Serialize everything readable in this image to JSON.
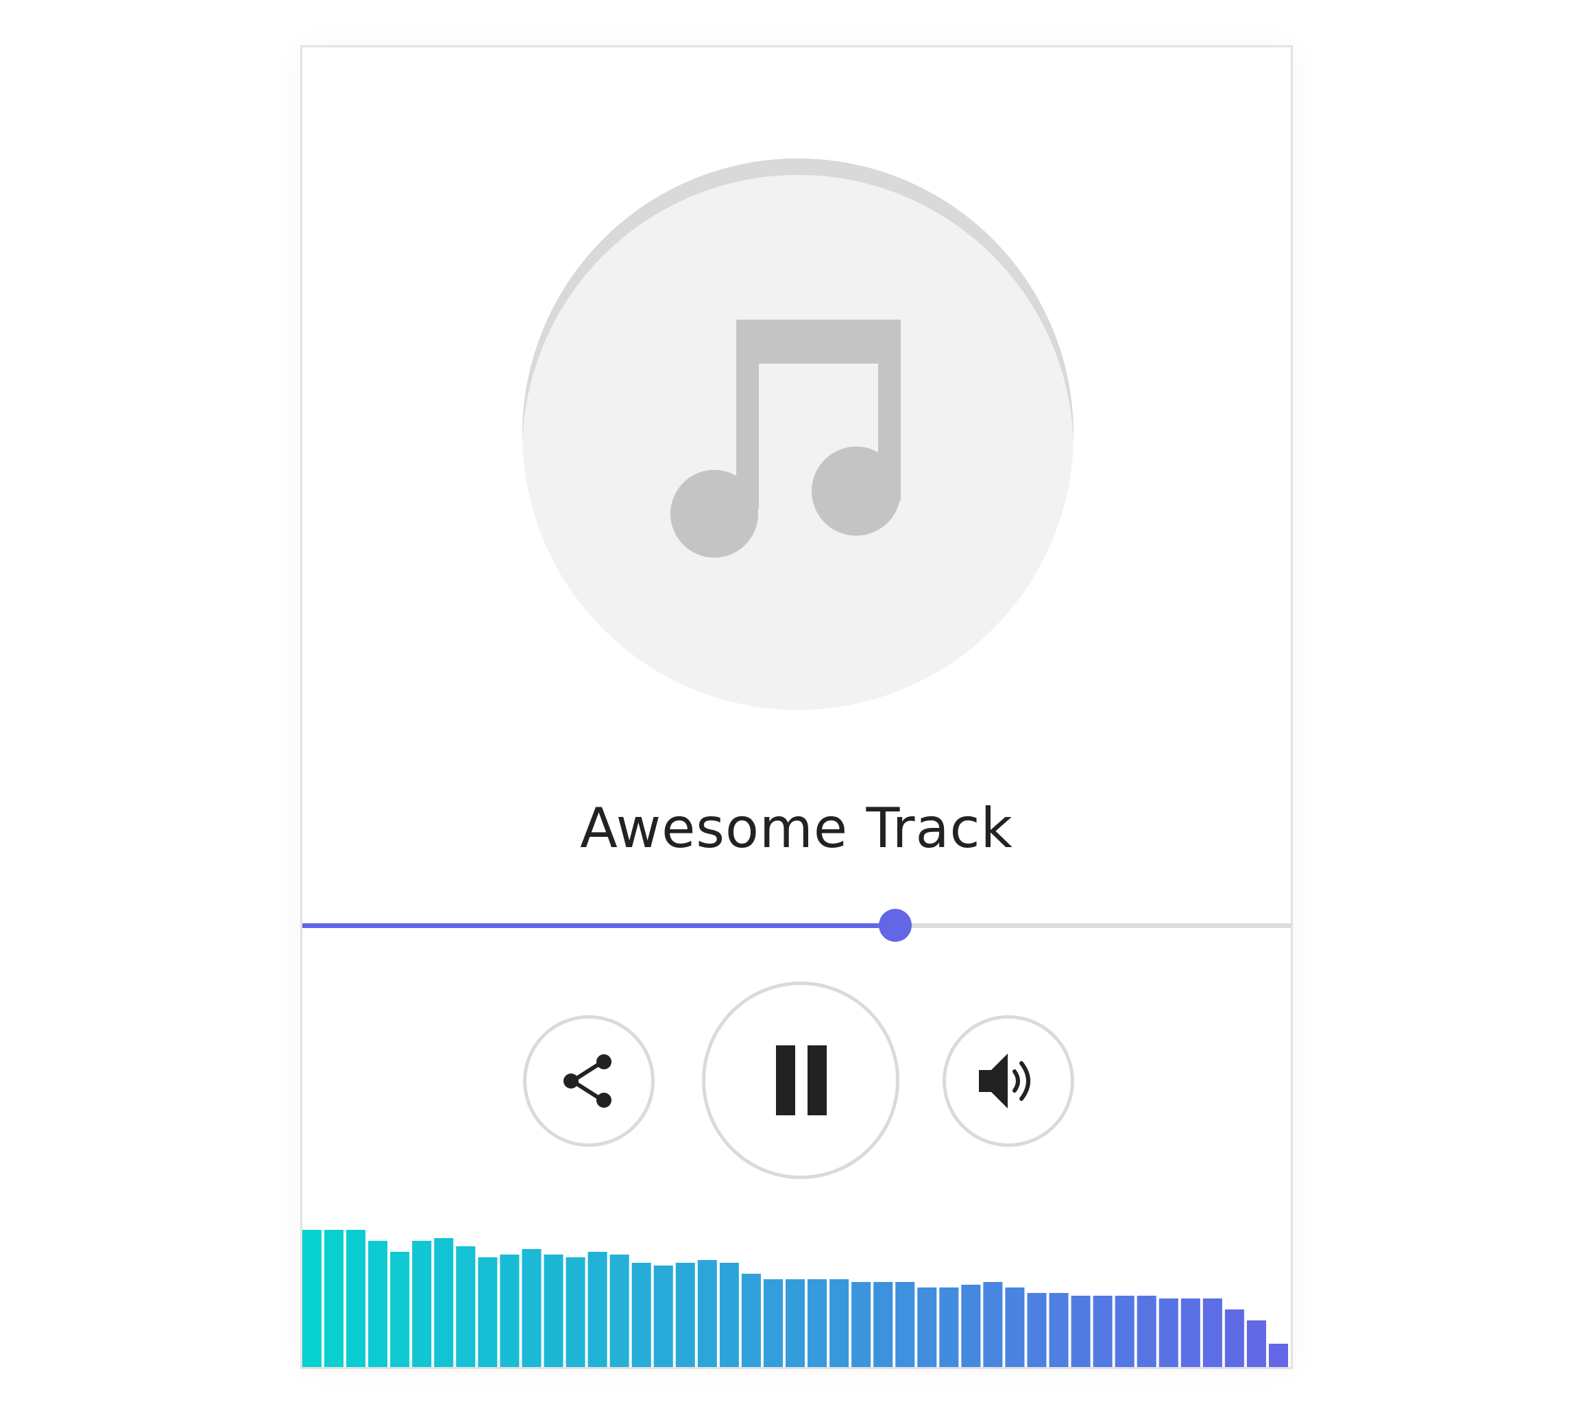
{
  "track": {
    "title": "Awesome Track"
  },
  "progress": {
    "fraction": 0.6
  },
  "controls": {
    "share_icon": "share-icon",
    "pause_icon": "pause-icon",
    "volume_icon": "volume-icon"
  },
  "colors": {
    "accent": "#6366e6",
    "bar_start": "#06d2d0",
    "bar_end": "#6366e6",
    "art_background": "#f2f2f2",
    "note": "#c4c4c4"
  },
  "visualizer": {
    "levels": [
      1.0,
      1.0,
      1.0,
      0.92,
      0.84,
      0.92,
      0.94,
      0.88,
      0.8,
      0.82,
      0.86,
      0.82,
      0.8,
      0.84,
      0.82,
      0.76,
      0.74,
      0.76,
      0.78,
      0.76,
      0.68,
      0.64,
      0.64,
      0.64,
      0.64,
      0.62,
      0.62,
      0.62,
      0.58,
      0.58,
      0.6,
      0.62,
      0.58,
      0.54,
      0.54,
      0.52,
      0.52,
      0.52,
      0.52,
      0.5,
      0.5,
      0.5,
      0.42,
      0.34,
      0.17
    ]
  }
}
